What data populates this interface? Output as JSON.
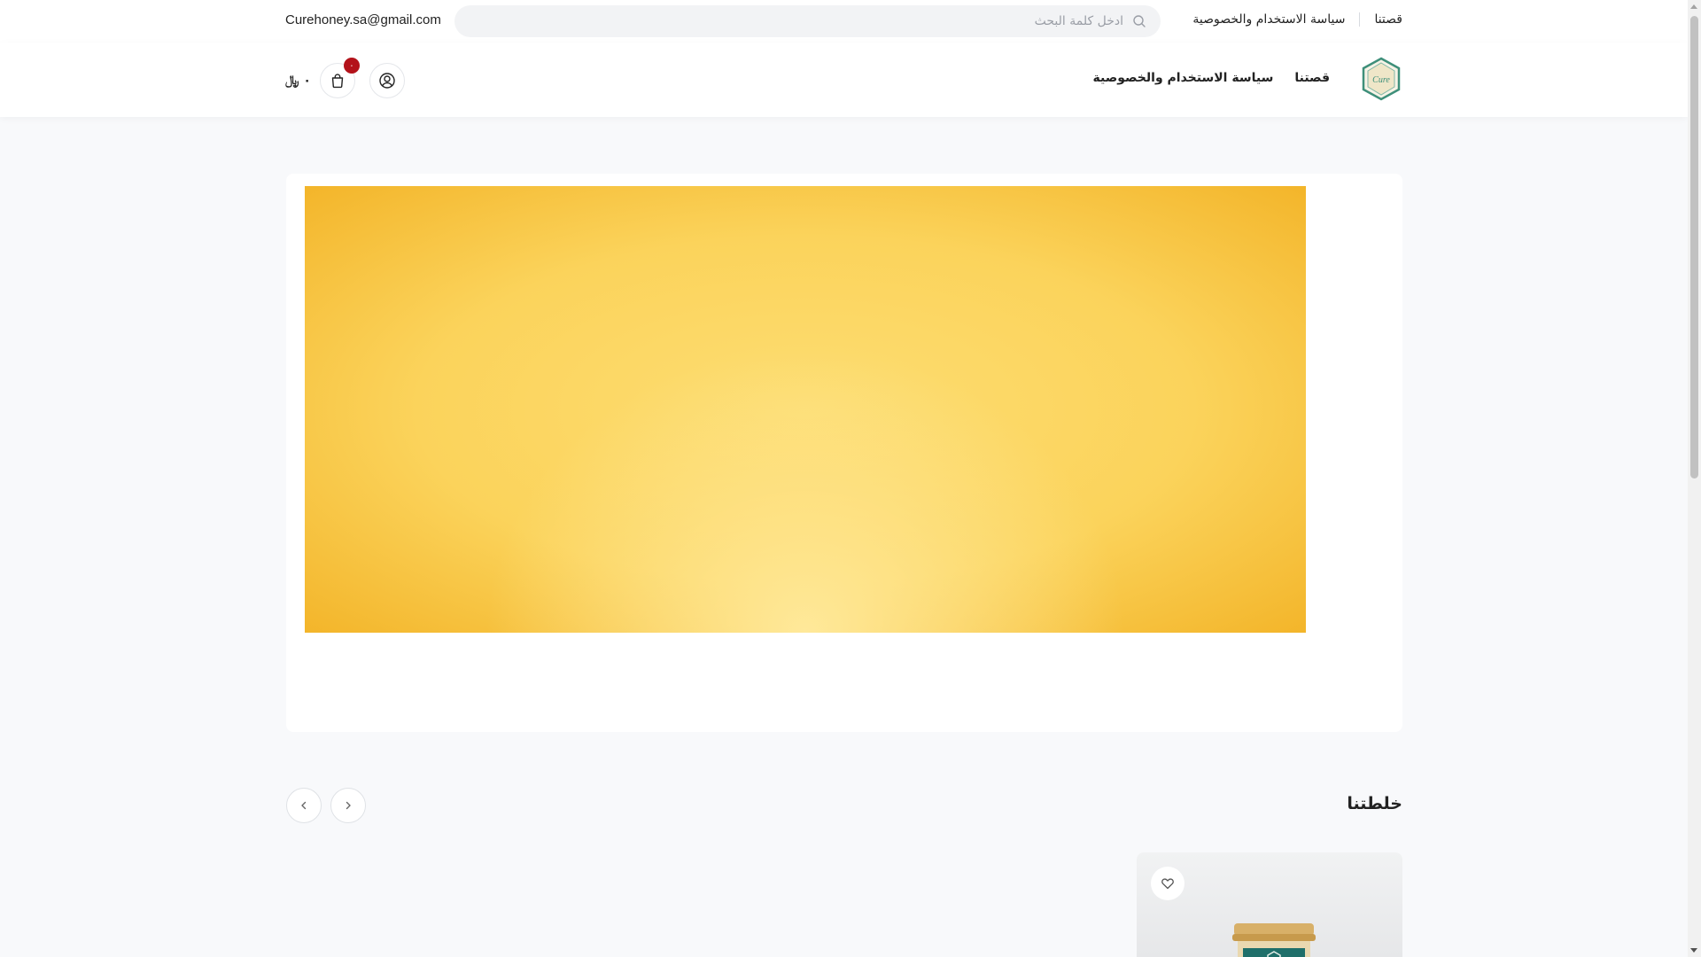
{
  "topbar": {
    "email": "Curehoney.sa@gmail.com",
    "search_placeholder": "ادخل كلمة البحث",
    "links": [
      "قصتنا",
      "سياسة الاستخدام والخصوصية"
    ]
  },
  "header": {
    "logo_text": "Cure",
    "nav": [
      "قصتنا",
      "سياسة الاستخدام والخصوصية"
    ],
    "cart_total": "٠ ﷼",
    "cart_count": "٠"
  },
  "section": {
    "title": "خلطتنا"
  },
  "colors": {
    "badge": "#b3121a",
    "banner_gold": "#f3b52a",
    "logo_green": "#3e8f7a"
  },
  "icons": {
    "search": "search-icon",
    "cart": "shopping-bag-icon",
    "account": "user-circle-icon",
    "prev": "chevron-left-icon",
    "next": "chevron-right-icon",
    "wishlist": "heart-icon"
  }
}
